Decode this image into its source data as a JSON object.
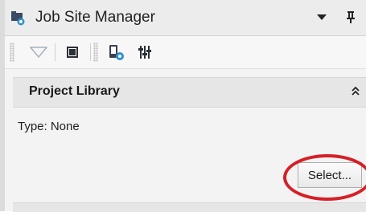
{
  "window": {
    "title": "Job Site Manager",
    "icons": {
      "app": "job-site-icon",
      "dropdown": "dropdown-arrow-icon",
      "pin": "pin-icon"
    }
  },
  "toolbar": {
    "buttons": [
      {
        "icon": "filter-icon"
      },
      {
        "icon": "terminal-icon"
      },
      {
        "icon": "device-settings-icon"
      },
      {
        "icon": "balance-icon"
      }
    ]
  },
  "section": {
    "title": "Project Library",
    "collapse_icon": "double-chevron-up-icon",
    "type_line": "Type: None",
    "select_label": "Select..."
  },
  "colors": {
    "highlight": "#d61f26",
    "accent": "#2f7fc1"
  }
}
